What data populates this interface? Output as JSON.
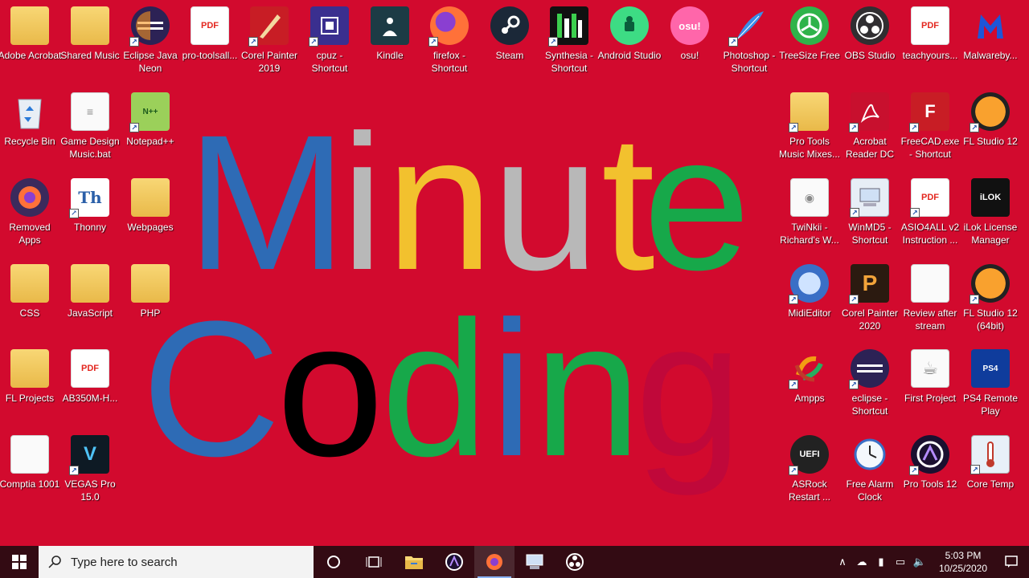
{
  "wallpaper": {
    "background": "#d20a2e",
    "word1": [
      {
        "ch": "M",
        "color": "#2e6bb5"
      },
      {
        "ch": "i",
        "color": "#b8b8b8"
      },
      {
        "ch": "n",
        "color": "#f2c12e"
      },
      {
        "ch": "u",
        "color": "#b8b8b8"
      },
      {
        "ch": "t",
        "color": "#f2c12e"
      },
      {
        "ch": "e",
        "color": "#17a84a"
      }
    ],
    "word2": [
      {
        "ch": "C",
        "color": "#2e6bb5"
      },
      {
        "ch": "o",
        "color": "#000000"
      },
      {
        "ch": "d",
        "color": "#17a84a"
      },
      {
        "ch": "i",
        "color": "#2e6bb5"
      },
      {
        "ch": "n",
        "color": "#17a84a"
      },
      {
        "ch": "g",
        "color": "#c0083a"
      }
    ]
  },
  "desktop_icons": {
    "adobe_acrobat": "Adobe Acrobat",
    "shared_music": "Shared Music",
    "eclipse_java": "Eclipse Java Neon",
    "pro_toolsall": "pro-toolsall...",
    "corel_painter_2019": "Corel Painter 2019",
    "cpuz": "cpuz - Shortcut",
    "kindle": "Kindle",
    "firefox": "firefox - Shortcut",
    "steam": "Steam",
    "synthesia": "Synthesia - Shortcut",
    "android_studio": "Android Studio",
    "osu": "osu!",
    "photoshop": "Photoshop - Shortcut",
    "treesize": "TreeSize Free",
    "obs": "OBS Studio",
    "teachyours": "teachyours...",
    "malwareby": "Malwareby...",
    "recycle_bin": "Recycle Bin",
    "game_design": "Game Design Music.bat",
    "notepadpp": "Notepad++",
    "removed_apps": "Removed Apps",
    "thonny": "Thonny",
    "webpages": "Webpages",
    "css": "CSS",
    "javascript": "JavaScript",
    "php": "PHP",
    "fl_projects": "FL Projects",
    "ab350m": "AB350M-H...",
    "comptia": "Comptia 1001",
    "vegas": "VEGAS Pro 15.0",
    "pro_tools_mixes": "Pro Tools Music Mixes...",
    "acrobat_reader": "Acrobat Reader DC",
    "freecad": "FreeCAD.exe - Shortcut",
    "fl_studio_12": "FL Studio 12",
    "twinkii": "TwiNkii - Richard's W...",
    "winmd5": "WinMD5 - Shortcut",
    "asio4all": "ASIO4ALL v2 Instruction ...",
    "ilok": "iLok License Manager",
    "midieditor": "MidiEditor",
    "corel_painter_2020": "Corel Painter 2020",
    "review_after": "Review after stream",
    "fl_studio_64": "FL Studio 12 (64bit)",
    "ampps": "Ampps",
    "eclipse_shortcut": "eclipse - Shortcut",
    "first_project": "First Project",
    "ps4_remote": "PS4 Remote Play",
    "asrock": "ASRock Restart ...",
    "free_alarm": "Free Alarm Clock",
    "pro_tools_12": "Pro Tools 12",
    "core_temp": "Core Temp"
  },
  "taskbar": {
    "search_placeholder": "Type here to search",
    "time": "5:03 PM",
    "date": "10/25/2020"
  }
}
